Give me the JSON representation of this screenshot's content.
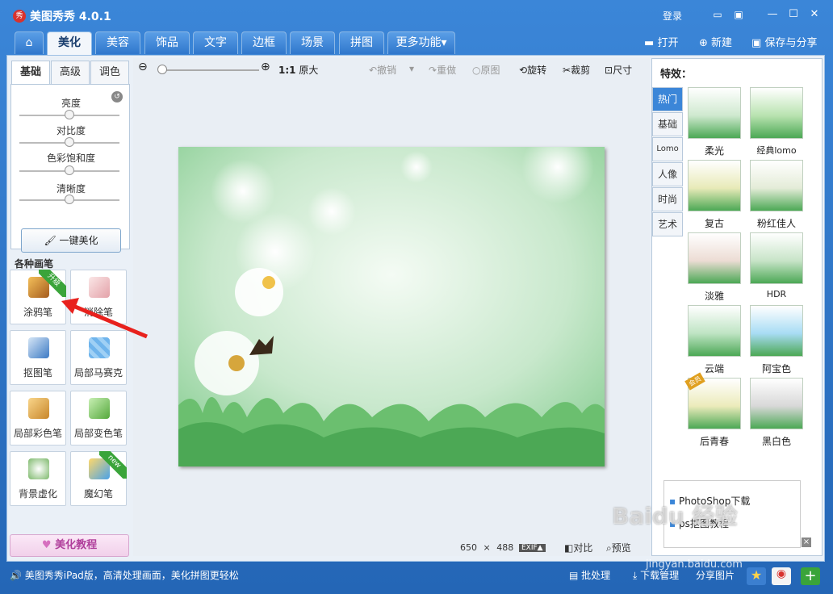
{
  "app": {
    "title": "美图秀秀 4.0.1",
    "logo_text": "秀"
  },
  "titlebar": {
    "login": "登录"
  },
  "menu": {
    "home_icon": "home-icon",
    "tabs": [
      "美化",
      "美容",
      "饰品",
      "文字",
      "边框",
      "场景",
      "拼图",
      "更多功能"
    ],
    "active": "美化",
    "open": "打开",
    "new": "新建",
    "save": "保存与分享"
  },
  "left": {
    "subtabs": [
      "基础",
      "高级",
      "调色"
    ],
    "sliders": [
      "亮度",
      "对比度",
      "色彩饱和度",
      "清晰度"
    ],
    "onekey": "一键美化",
    "brush_title": "各种画笔",
    "brushes": [
      {
        "label": "涂鸦笔",
        "badge": "升级"
      },
      {
        "label": "消除笔",
        "badge": ""
      },
      {
        "label": "抠图笔",
        "badge": ""
      },
      {
        "label": "局部马赛克",
        "badge": ""
      },
      {
        "label": "局部彩色笔",
        "badge": ""
      },
      {
        "label": "局部变色笔",
        "badge": ""
      },
      {
        "label": "背景虚化",
        "badge": ""
      },
      {
        "label": "魔幻笔",
        "badge": "new"
      }
    ],
    "tutorial": "美化教程"
  },
  "toolbar": {
    "ratio": "1:1",
    "original_size": "原大",
    "undo": "撤销",
    "redo": "重做",
    "original": "原图",
    "rotate": "旋转",
    "crop": "裁剪",
    "size": "尺寸"
  },
  "canvas": {
    "width_px": "650",
    "times": "×",
    "height_px": "488",
    "exif": "EXIF▲",
    "compare": "对比",
    "preview": "预览"
  },
  "effects": {
    "title": "特效：",
    "categories": [
      "热门",
      "基础",
      "Lomo",
      "人像",
      "时尚",
      "艺术"
    ],
    "active_category": "热门",
    "items": [
      {
        "label": "柔光",
        "color": "#cfe9cf"
      },
      {
        "label": "经典lomo",
        "color": "#b9e3b0"
      },
      {
        "label": "复古",
        "color": "#e8eab8"
      },
      {
        "label": "粉红佳人",
        "color": "#e4ecd8"
      },
      {
        "label": "淡雅",
        "color": "#ecdcd4"
      },
      {
        "label": "HDR",
        "color": "#c8e4c8"
      },
      {
        "label": "云端",
        "color": "#bfe4c4"
      },
      {
        "label": "阿宝色",
        "color": "#a8dcf4"
      },
      {
        "label": "后青春",
        "color": "#ecebbb"
      },
      {
        "label": "黑白色",
        "color": "#d8d8d8"
      }
    ],
    "corner_badge": "会员"
  },
  "ad": {
    "links": [
      "PhotoShop下载",
      "ps抠图教程"
    ],
    "close": "×"
  },
  "bottom": {
    "announce": "美图秀秀iPad版，高清处理画面，美化拼图更轻松",
    "batch": "批处理",
    "download": "下载管理",
    "share": "分享图片"
  },
  "watermark": {
    "main": "Baidu 经验",
    "url": "jingyan.baidu.com"
  },
  "colors": {
    "accent": "#3b86d8",
    "arrow": "#e8211d",
    "ribbon": "#3aa43a"
  }
}
